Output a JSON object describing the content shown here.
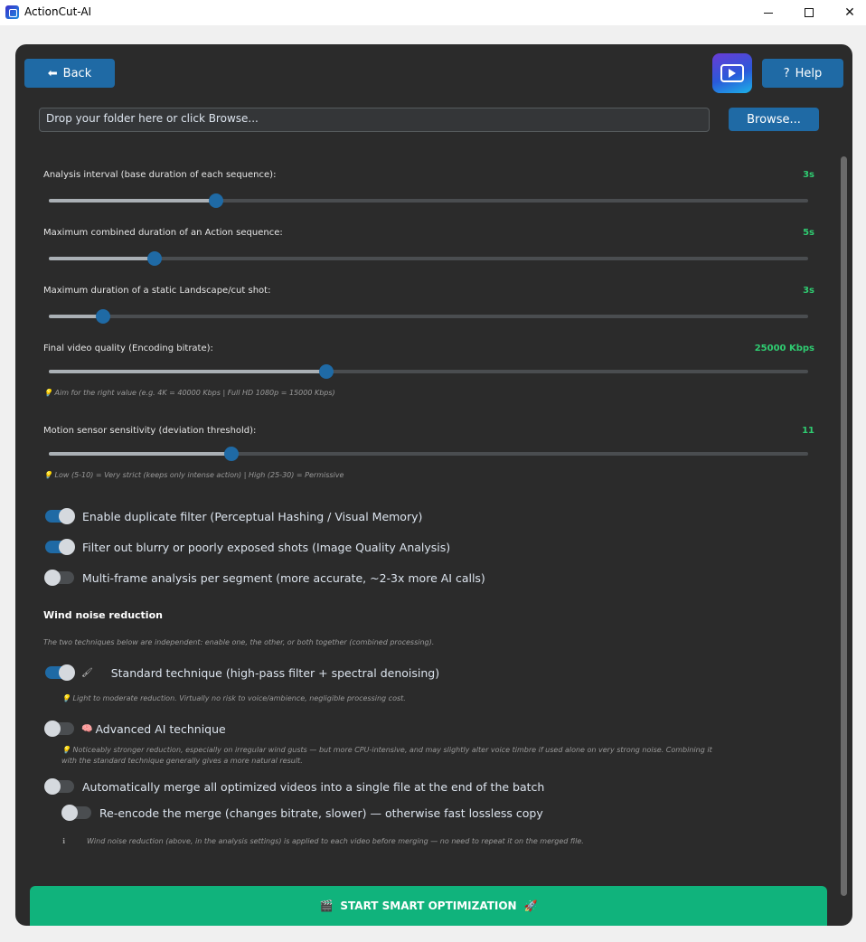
{
  "window": {
    "title": "ActionCut-AI",
    "minimize": "—",
    "maximize": "☐",
    "close": "✕"
  },
  "header": {
    "back_label": "Back",
    "back_icon": "⬅",
    "help_label": "Help",
    "help_icon": "?"
  },
  "folder": {
    "placeholder": "Drop your folder here or click Browse...",
    "browse_label": "Browse..."
  },
  "sliders": [
    {
      "label": "Analysis interval (base duration of each sequence):",
      "value": "3s",
      "fraction": 0.22
    },
    {
      "label": "Maximum combined duration of an Action sequence:",
      "value": "5s",
      "fraction": 0.139
    },
    {
      "label": "Maximum duration of a static Landscape/cut shot:",
      "value": "3s",
      "fraction": 0.071
    },
    {
      "label": "Final video quality (Encoding bitrate):",
      "value": "25000 Kbps",
      "fraction": 0.365,
      "hint": "💡 Aim for the right value (e.g. 4K = 40000 Kbps | Full HD 1080p = 15000 Kbps)"
    },
    {
      "label": "Motion sensor sensitivity (deviation threshold):",
      "value": "11",
      "fraction": 0.241,
      "hint": "💡 Low (5-10) = Very strict (keeps only intense action) | High (25-30) = Permissive"
    }
  ],
  "toggles": {
    "duplicate": {
      "label": "Enable duplicate filter (Perceptual Hashing / Visual Memory)",
      "on": true
    },
    "blurry": {
      "label": "Filter out blurry or poorly exposed shots (Image Quality Analysis)",
      "on": true
    },
    "multiframe": {
      "label": "Multi-frame analysis per segment (more accurate, ~2-3x more AI calls)",
      "on": false
    }
  },
  "wind": {
    "title": "Wind noise reduction",
    "intro": "The two techniques below are independent: enable one, the other, or both together (combined processing).",
    "standard": {
      "label": "Standard technique (high-pass filter + spectral denoising)",
      "icon": "🖌",
      "on": true,
      "hint": "💡 Light to moderate reduction. Virtually no risk to voice/ambience, negligible processing cost."
    },
    "advanced": {
      "label": "Advanced AI technique",
      "icon": "🧠",
      "on": false,
      "hint_line1": "💡 Noticeably stronger reduction, especially on irregular wind gusts — but more CPU-intensive, and may slightly alter voice timbre if used alone on very strong noise. Combining it",
      "hint_line2": "with the standard technique generally gives a more natural result."
    }
  },
  "merge": {
    "label": "Automatically merge all optimized videos into a single file at the end of the batch",
    "on": false,
    "reencode_label": "Re-encode the merge (changes bitrate, slower) — otherwise fast lossless copy",
    "reencode_on": false,
    "info_icon": "ℹ",
    "info_text": "Wind noise reduction (above, in the analysis settings) is applied to each video before merging — no need to repeat it on the merged file."
  },
  "start": {
    "label": "START SMART OPTIMIZATION",
    "icon_left": "🎬",
    "icon_right": "🚀"
  }
}
